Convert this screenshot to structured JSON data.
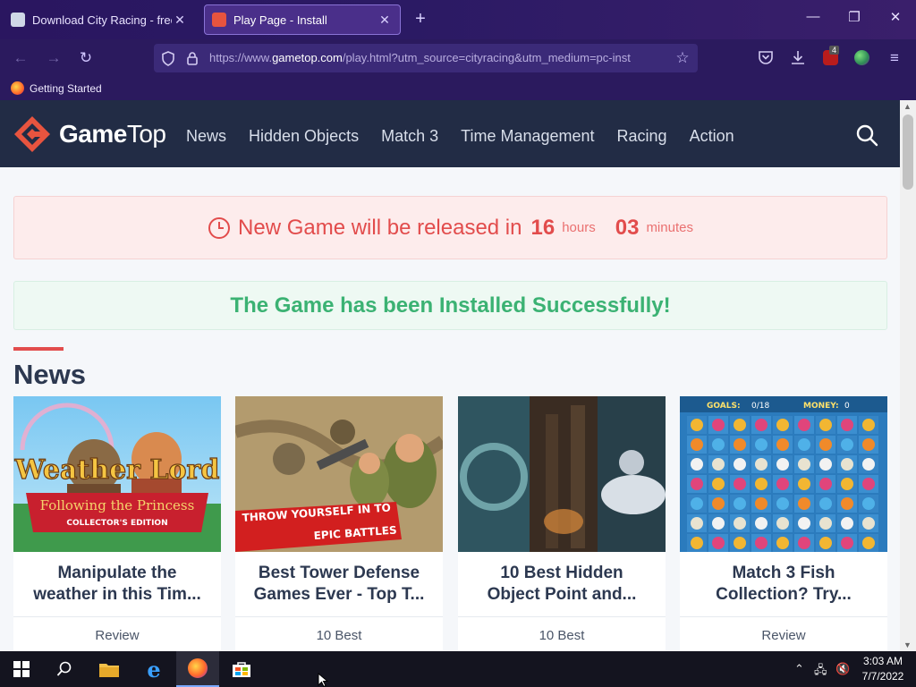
{
  "browser": {
    "tabs": [
      {
        "title": "Download City Racing - free - la",
        "active": false
      },
      {
        "title": "Play Page - Install",
        "active": true
      }
    ],
    "new_tab_icon": "plus-icon",
    "window": {
      "minimize": "—",
      "restore": "❐",
      "close": "✕"
    },
    "url": {
      "prefix": "https://www.",
      "host": "gametop.com",
      "path": "/play.html?utm_source=cityracing&utm_medium=pc-inst"
    },
    "extension_badge": "4",
    "bookmarks": [
      {
        "label": "Getting Started"
      }
    ]
  },
  "site": {
    "logo_text_a": "Game",
    "logo_text_b": "Top",
    "menu": [
      "News",
      "Hidden Objects",
      "Match 3",
      "Time Management",
      "Racing",
      "Action"
    ],
    "countdown": {
      "message": "New Game will be released in",
      "hours": "16",
      "hours_label": "hours",
      "minutes": "03",
      "minutes_label": "minutes"
    },
    "success_message": "The Game has been Installed Successfully!",
    "news_heading": "News",
    "cards": [
      {
        "title_line1": "Manipulate the",
        "title_line2": "weather in this Tim...",
        "category": "Review",
        "thumb_text1": "Weather Lord",
        "thumb_text2": "Following the Princess",
        "thumb_text3": "COLLECTOR'S EDITION"
      },
      {
        "title_line1": "Best Tower Defense",
        "title_line2": "Games Ever - Top T...",
        "category": "10 Best",
        "thumb_text1": "THROW YOURSELF IN TO",
        "thumb_text2": "EPIC BATTLES"
      },
      {
        "title_line1": "10 Best Hidden",
        "title_line2": "Object Point and...",
        "category": "10 Best"
      },
      {
        "title_line1": "Match 3 Fish",
        "title_line2": "Collection? Try...",
        "category": "Review",
        "thumb_text1": "GOALS:",
        "thumb_text2": "0/18",
        "thumb_text3": "MONEY:",
        "thumb_text4": "0"
      }
    ]
  },
  "taskbar": {
    "time": "3:03 AM",
    "date": "7/7/2022"
  },
  "colors": {
    "accent_red": "#e24c4c",
    "success_green": "#3bb273",
    "header_bg": "#222c45",
    "browser_purple": "#2b1a5e"
  }
}
